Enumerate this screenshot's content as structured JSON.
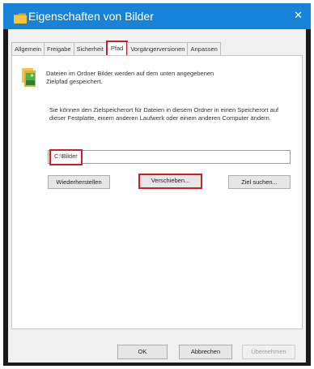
{
  "window": {
    "title": "Eigenschaften von Bilder",
    "close_glyph": "✕"
  },
  "tabs": [
    {
      "label": "Allgemein"
    },
    {
      "label": "Freigabe"
    },
    {
      "label": "Sicherheit"
    },
    {
      "label": "Pfad"
    },
    {
      "label": "Vorgängerversionen"
    },
    {
      "label": "Anpassen"
    }
  ],
  "active_tab": "Pfad",
  "pfad": {
    "description_1": "Dateien im Ordner Bilder werden auf dem unten angegebenen Zielpfad gespeichert.",
    "description_2": "Sie können den Zielspeicherort für Dateien in diesem Ordner in einen Speicherort auf dieser Festplatte, einem anderen Laufwerk oder einem anderen Computer ändern.",
    "path_value": "C:\\Bilder",
    "restore_button": "Wiederherstellen",
    "move_button": "Verschieben...",
    "find_target_button": "Ziel suchen..."
  },
  "footer": {
    "ok": "OK",
    "cancel": "Abbrechen",
    "apply": "Übernehmen"
  },
  "colors": {
    "titlebar": "#1683d8",
    "highlight": "#cc1f2a",
    "folder_yellow": "#f5c542"
  },
  "icons": {
    "folder": "folder-icon",
    "pictures": "pictures-folder-icon",
    "close": "close-icon"
  }
}
